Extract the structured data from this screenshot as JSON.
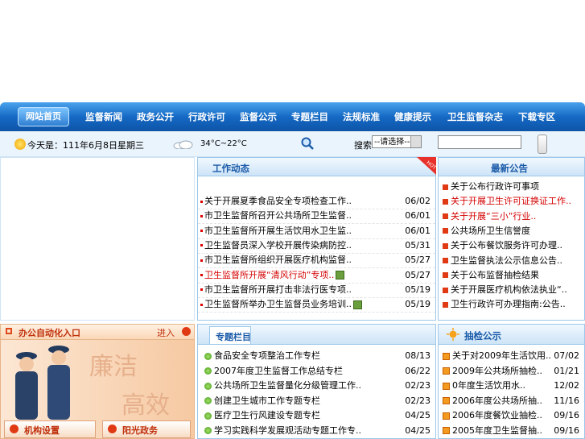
{
  "nav": {
    "home": "网站首页",
    "items": [
      "监督新闻",
      "政务公开",
      "行政许可",
      "监督公示",
      "专题栏目",
      "法规标准",
      "健康提示",
      "卫生监督杂志",
      "下载专区"
    ]
  },
  "info": {
    "date": "今天是：111年6月8日星期三",
    "weather": "34°C~22°C",
    "search_label": "搜索",
    "select_value": "--请选择--",
    "search_placeholder": ""
  },
  "work_news": {
    "title": "工作动态",
    "hot_badge": "HOT",
    "items": [
      {
        "text": "关于开展夏季食品安全专项检查工作..",
        "date": "06/02",
        "red": false,
        "new": false
      },
      {
        "text": "市卫生监督所召开公共场所卫生监督..",
        "date": "06/01",
        "red": false,
        "new": false
      },
      {
        "text": "市卫生监督所开展生活饮用水卫生监..",
        "date": "06/01",
        "red": false,
        "new": false
      },
      {
        "text": "卫生监督员深入学校开展传染病防控..",
        "date": "05/31",
        "red": false,
        "new": false
      },
      {
        "text": "市卫生监督所组织开展医疗机构监督..",
        "date": "05/27",
        "red": false,
        "new": false
      },
      {
        "text": "卫生监督所开展“清风行动”专项..",
        "date": "05/27",
        "red": true,
        "new": true
      },
      {
        "text": "市卫生监督所开展打击非法行医专项..",
        "date": "05/19",
        "red": false,
        "new": false
      },
      {
        "text": "卫生监督所举办卫生监督员业务培训..",
        "date": "05/19",
        "red": false,
        "new": true
      }
    ]
  },
  "announcements": {
    "title": "最新公告",
    "items": [
      {
        "text": "关于公布行政许可事项",
        "red": false
      },
      {
        "text": "关于开展卫生许可证换证工作..",
        "red": true
      },
      {
        "text": "关于开展“三小”行业..",
        "red": true
      },
      {
        "text": "公共场所卫生信誉度",
        "red": false
      },
      {
        "text": "关于公布餐饮服务许可办理..",
        "red": false
      },
      {
        "text": "卫生监督执法公示信息公告..",
        "red": false
      },
      {
        "text": "关于公布监督抽检结果",
        "red": false
      },
      {
        "text": "关于开展医疗机构依法执业“..",
        "red": false
      },
      {
        "text": "卫生行政许可办理指南:公告..",
        "red": false
      }
    ]
  },
  "office": {
    "title": "办公自动化入口",
    "enter": "进入",
    "banner_text_1": "廉洁",
    "banner_text_2": "高效",
    "btn_org": "机构设置",
    "btn_sun": "阳光政务"
  },
  "topics": {
    "title": "专题栏目",
    "items": [
      {
        "text": "食品安全专项整治工作专栏",
        "date": "08/13"
      },
      {
        "text": "2007年度卫生监督工作总结专栏",
        "date": "06/22"
      },
      {
        "text": "公共场所卫生监督量化分级管理工作..",
        "date": "02/23"
      },
      {
        "text": "创建卫生城市工作专题专栏",
        "date": "02/23"
      },
      {
        "text": "医疗卫生行风建设专题专栏",
        "date": "04/25"
      },
      {
        "text": "学习实践科学发展观活动专题工作专..",
        "date": "04/25"
      }
    ]
  },
  "inspection": {
    "title": "抽检公示",
    "items": [
      {
        "text": "关于对2009年生活饮用..",
        "date": "07/02"
      },
      {
        "text": "2009年公共场所抽检..",
        "date": "01/21"
      },
      {
        "text": "0年度生活饮用水..",
        "date": "12/02"
      },
      {
        "text": "2006年度公共场所抽..",
        "date": "11/16"
      },
      {
        "text": "2006年度餐饮业抽检..",
        "date": "09/16"
      },
      {
        "text": "2005年度卫生监督抽..",
        "date": "09/16"
      }
    ]
  },
  "colors": {
    "nav_blue": "#1569c4",
    "accent_red": "#d40000",
    "title_blue": "#1a5aa8"
  }
}
